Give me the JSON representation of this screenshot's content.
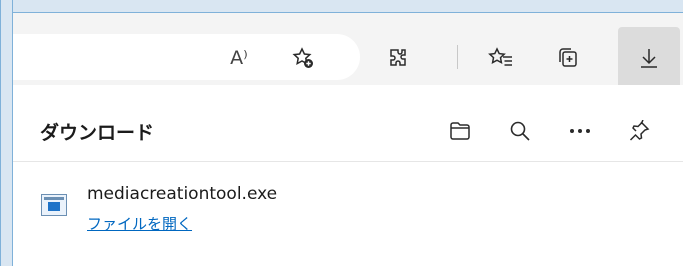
{
  "toolbar": {
    "icons": [
      "read-aloud-icon",
      "add-favorite-icon",
      "extensions-icon",
      "favorites-icon",
      "collections-icon",
      "downloads-icon"
    ],
    "read_aloud_glyph": "A⁾"
  },
  "downloads_panel": {
    "title": "ダウンロード",
    "header_icons": [
      "open-folder-icon",
      "search-icon",
      "more-options-icon",
      "pin-icon"
    ],
    "items": [
      {
        "file_name": "mediacreationtool.exe",
        "action_link": "ファイルを開く"
      }
    ]
  },
  "colors": {
    "link": "#0067c0",
    "active_button_bg": "#dcdcdc",
    "frame_accent": "#7fb1d9"
  }
}
